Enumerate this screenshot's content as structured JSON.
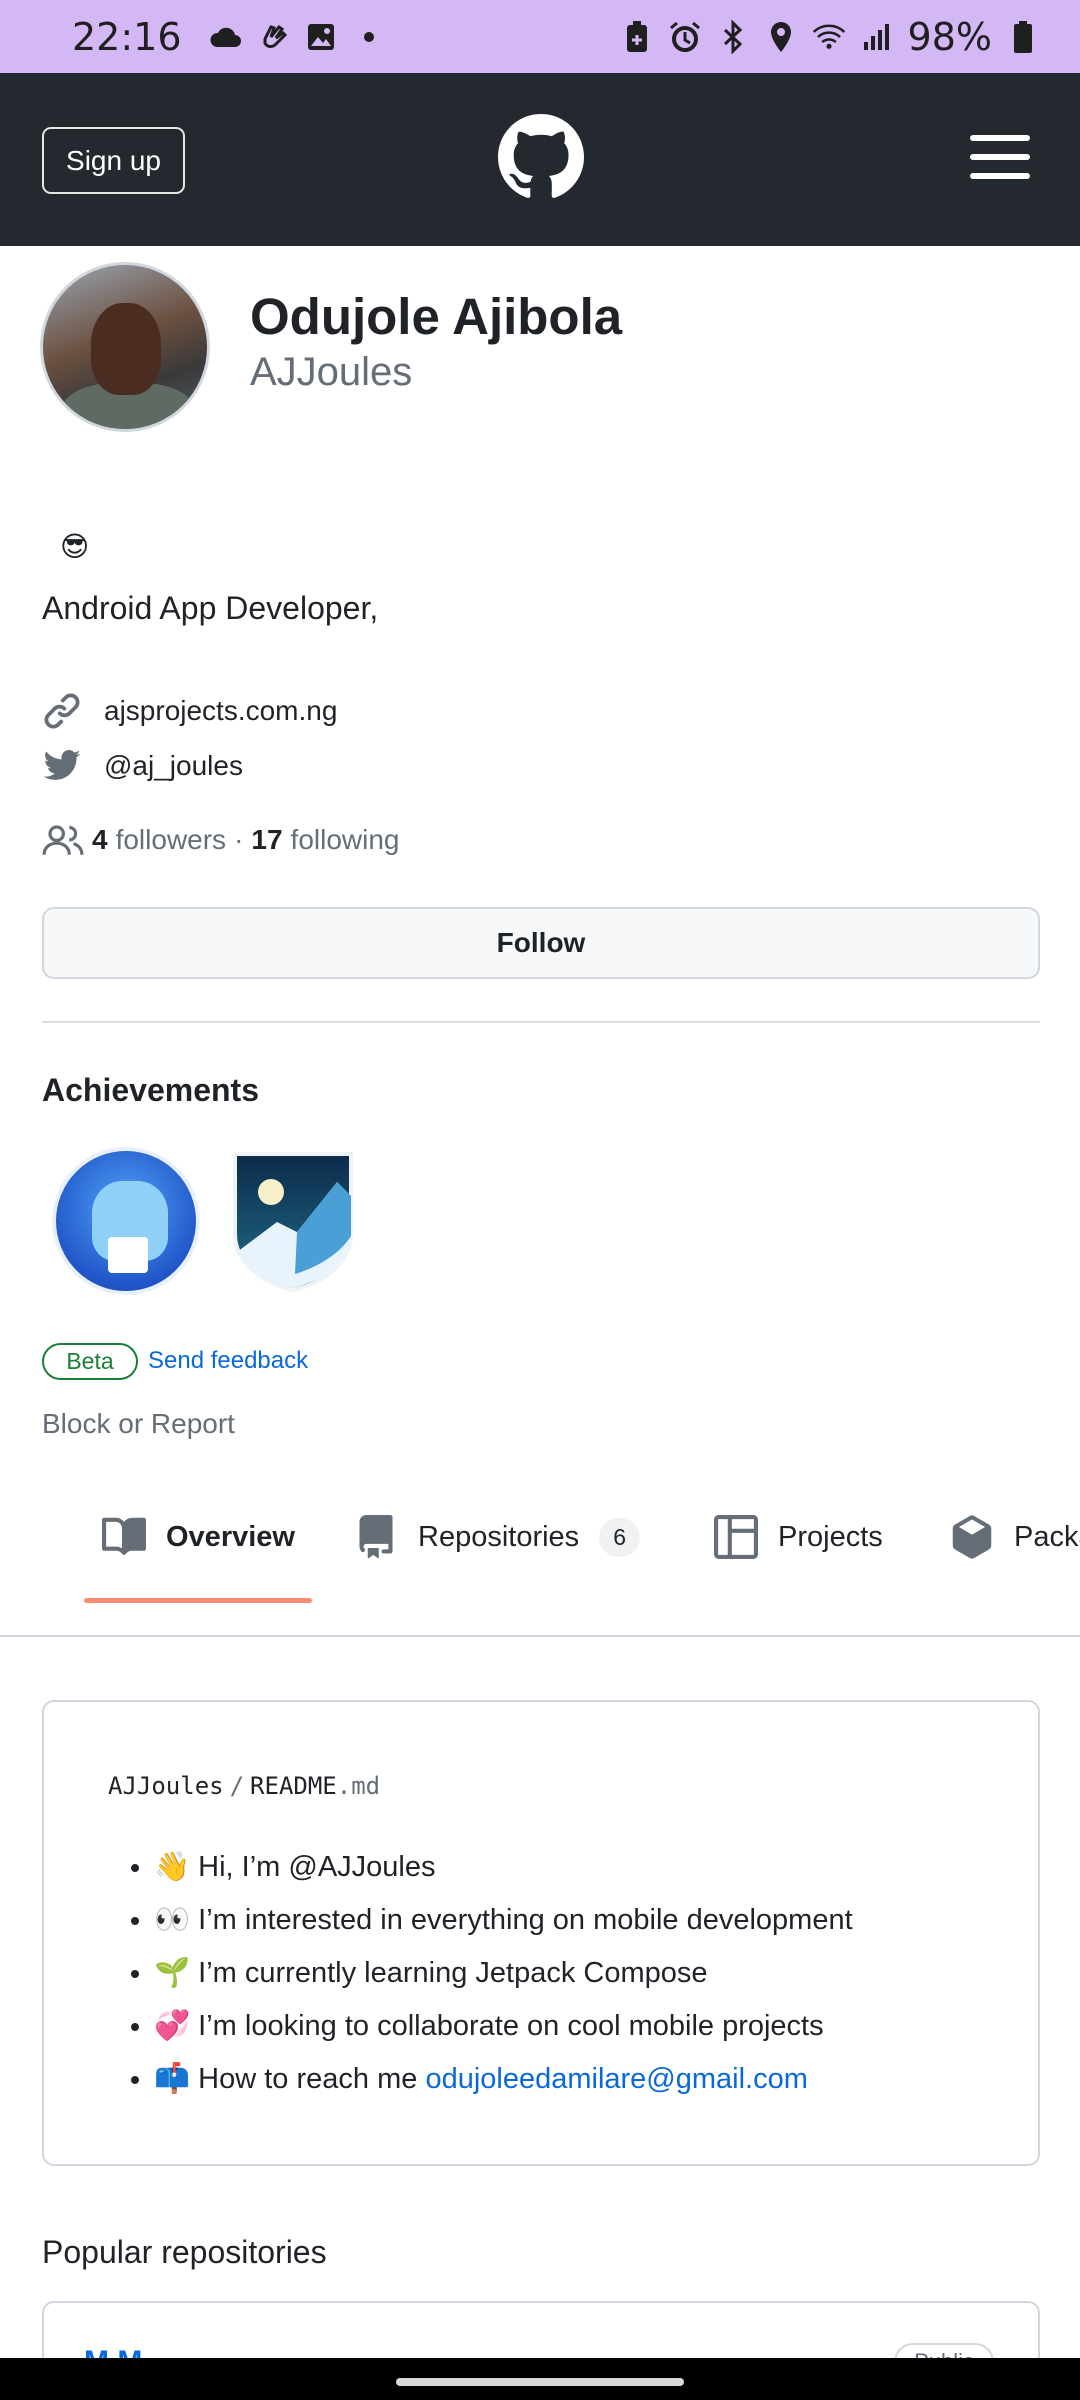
{
  "status_bar": {
    "time": "22:16",
    "battery": "98%",
    "icons_left": [
      "cloud-icon",
      "hand-icon",
      "image-icon",
      "dot-icon"
    ],
    "icons_right": [
      "battery-saver-icon",
      "alarm-icon",
      "bluetooth-icon",
      "location-icon",
      "wifi-icon",
      "signal-icon",
      "battery-icon"
    ]
  },
  "header": {
    "signup_label": "Sign up"
  },
  "profile": {
    "full_name": "Odujole Ajibola",
    "username": "AJJoules",
    "status_emoji": "😎",
    "bio": "Android App Developer,",
    "website": "ajsprojects.com.ng",
    "twitter": "@aj_joules",
    "followers_count": "4",
    "followers_label": "followers",
    "separator": "·",
    "following_count": "17",
    "following_label": "following",
    "follow_label": "Follow"
  },
  "achievements": {
    "title": "Achievements",
    "beta_label": "Beta",
    "feedback_label": "Send feedback"
  },
  "block_label": "Block or Report",
  "tabs": [
    {
      "label": "Overview",
      "icon": "book-icon"
    },
    {
      "label": "Repositories",
      "count": "6",
      "icon": "repo-icon"
    },
    {
      "label": "Projects",
      "icon": "table-icon"
    },
    {
      "label": "Packa",
      "icon": "package-icon"
    }
  ],
  "readme": {
    "owner": "AJJoules",
    "slash": "/",
    "file_base": "README",
    "file_ext": ".md",
    "items": [
      {
        "emoji": "👋",
        "text": "Hi, I’m @AJJoules"
      },
      {
        "emoji": "👀",
        "text": "I’m interested in everything on mobile development"
      },
      {
        "emoji": "🌱",
        "text": "I’m currently learning Jetpack Compose"
      },
      {
        "emoji": "💞️",
        "text": "I’m looking to collaborate on cool mobile projects"
      },
      {
        "emoji": "📫",
        "text": "How to reach me ",
        "link": "odujoleedamilare@gmail.com"
      }
    ]
  },
  "popular": {
    "title": "Popular repositories",
    "first_repo": "M M",
    "visibility": "Public"
  },
  "colors": {
    "status_bar_bg": "#d3b8f5",
    "header_bg": "#24292f",
    "link": "#0969da",
    "tab_underline": "#fd8c73",
    "beta": "#1a7f37"
  }
}
